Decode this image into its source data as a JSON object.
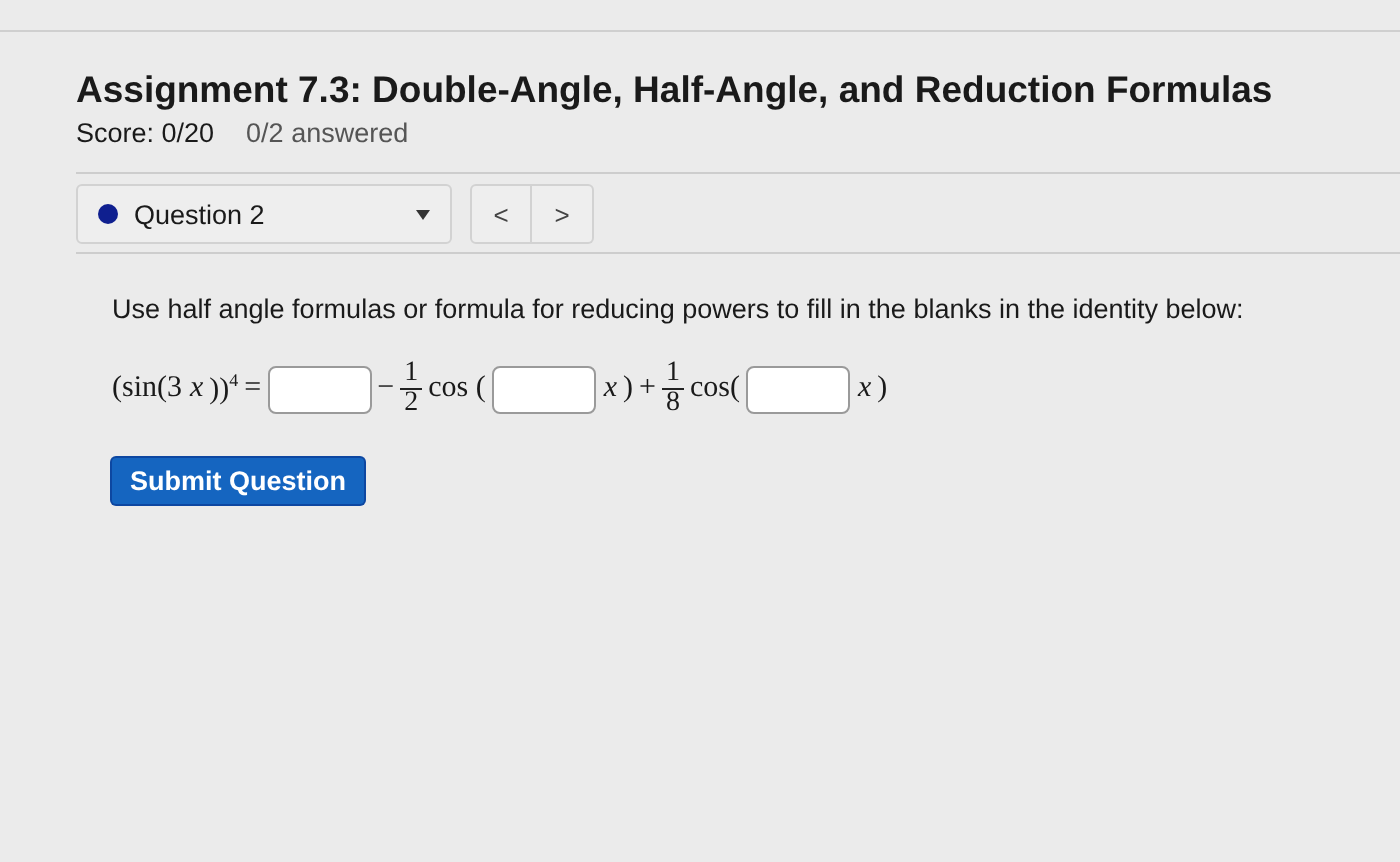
{
  "assignment": {
    "title": "Assignment 7.3: Double-Angle, Half-Angle, and Reduction Formulas",
    "score": "Score: 0/20",
    "answered": "0/2 answered"
  },
  "question_nav": {
    "selector": "Question 2",
    "previous": "<",
    "next": ">"
  },
  "question": {
    "prompt": "Use half angle formulas or formula for reducing powers to fill in the blanks in the identity below:",
    "equation": [
      {
        "kind": "text",
        "text": "(sin(3"
      },
      {
        "kind": "var",
        "text": "x"
      },
      {
        "kind": "text",
        "text": "))$^{4}$"
      },
      {
        "kind": "text",
        "text": "="
      },
      {
        "kind": "blank"
      },
      {
        "kind": "text",
        "text": "−"
      },
      {
        "kind": "fraction",
        "numerator": "1",
        "denominator": "2"
      },
      {
        "kind": "text",
        "text": "cos ("
      },
      {
        "kind": "blank"
      },
      {
        "kind": "var",
        "text": "x"
      },
      {
        "kind": "text",
        "text": ")"
      },
      {
        "kind": "text",
        "text": "+"
      },
      {
        "kind": "fraction",
        "numerator": "1",
        "denominator": "8"
      },
      {
        "kind": "text",
        "text": "cos("
      },
      {
        "kind": "blank"
      },
      {
        "kind": "var",
        "text": "x"
      },
      {
        "kind": "text",
        "text": ")"
      }
    ]
  },
  "submit": "Submit Question"
}
